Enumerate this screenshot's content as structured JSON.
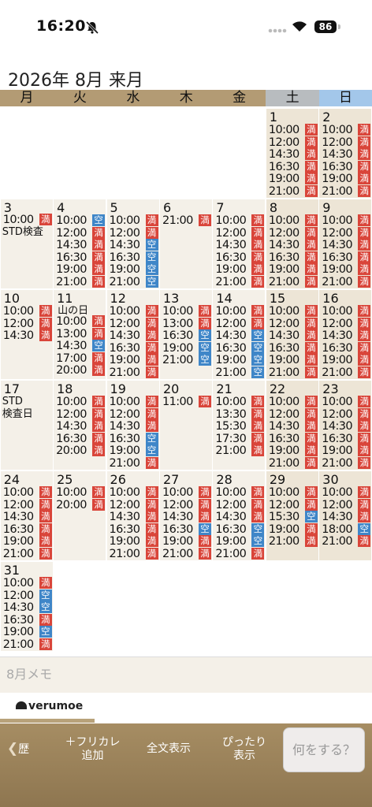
{
  "status_bar": {
    "time": "16:20",
    "battery": "86"
  },
  "calendar": {
    "title": "2026年 8月 来月",
    "weekdays": [
      {
        "label": "月",
        "color": "#b39b74"
      },
      {
        "label": "火",
        "color": "#b39b74"
      },
      {
        "label": "水",
        "color": "#b39b74"
      },
      {
        "label": "木",
        "color": "#b39b74"
      },
      {
        "label": "金",
        "color": "#b39b74"
      },
      {
        "label": "土",
        "color": "#b8bcbf"
      },
      {
        "label": "日",
        "color": "#a3c7ea"
      }
    ],
    "colors": {
      "full": "#d9453a",
      "open": "#3f86c8"
    },
    "badges": {
      "full": "満",
      "open": "空"
    },
    "days": [
      {
        "date": "1",
        "slots": [
          {
            "time": "10:00",
            "status": "full"
          },
          {
            "time": "12:00",
            "status": "full"
          },
          {
            "time": "14:30",
            "status": "full"
          },
          {
            "time": "16:30",
            "status": "full"
          },
          {
            "time": "19:00",
            "status": "full"
          },
          {
            "time": "21:00",
            "status": "full"
          }
        ]
      },
      {
        "date": "2",
        "slots": [
          {
            "time": "10:00",
            "status": "full"
          },
          {
            "time": "12:00",
            "status": "full"
          },
          {
            "time": "14:30",
            "status": "full"
          },
          {
            "time": "16:30",
            "status": "full"
          },
          {
            "time": "19:00",
            "status": "full"
          },
          {
            "time": "21:00",
            "status": "full"
          }
        ]
      },
      {
        "date": "3",
        "note": "STD検査",
        "slots": [
          {
            "time": "10:00",
            "status": "full"
          }
        ]
      },
      {
        "date": "4",
        "slots": [
          {
            "time": "10:00",
            "status": "open"
          },
          {
            "time": "12:00",
            "status": "full"
          },
          {
            "time": "14:30",
            "status": "full"
          },
          {
            "time": "16:30",
            "status": "full"
          },
          {
            "time": "19:00",
            "status": "full"
          },
          {
            "time": "21:00",
            "status": "full"
          }
        ]
      },
      {
        "date": "5",
        "slots": [
          {
            "time": "10:00",
            "status": "full"
          },
          {
            "time": "12:00",
            "status": "full"
          },
          {
            "time": "14:30",
            "status": "open"
          },
          {
            "time": "16:30",
            "status": "open"
          },
          {
            "time": "19:00",
            "status": "open"
          },
          {
            "time": "21:00",
            "status": "open"
          }
        ]
      },
      {
        "date": "6",
        "slots": [
          {
            "time": "21:00",
            "status": "full"
          }
        ]
      },
      {
        "date": "7",
        "slots": [
          {
            "time": "10:00",
            "status": "full"
          },
          {
            "time": "12:00",
            "status": "full"
          },
          {
            "time": "14:30",
            "status": "full"
          },
          {
            "time": "16:30",
            "status": "full"
          },
          {
            "time": "19:00",
            "status": "full"
          },
          {
            "time": "21:00",
            "status": "full"
          }
        ]
      },
      {
        "date": "8",
        "slots": [
          {
            "time": "10:00",
            "status": "full"
          },
          {
            "time": "12:00",
            "status": "full"
          },
          {
            "time": "14:30",
            "status": "full"
          },
          {
            "time": "16:30",
            "status": "full"
          },
          {
            "time": "19:00",
            "status": "full"
          },
          {
            "time": "21:00",
            "status": "full"
          }
        ]
      },
      {
        "date": "9",
        "slots": [
          {
            "time": "10:00",
            "status": "full"
          },
          {
            "time": "12:00",
            "status": "full"
          },
          {
            "time": "14:30",
            "status": "full"
          },
          {
            "time": "16:30",
            "status": "full"
          },
          {
            "time": "19:00",
            "status": "full"
          },
          {
            "time": "21:00",
            "status": "full"
          }
        ]
      },
      {
        "date": "10",
        "slots": [
          {
            "time": "10:00",
            "status": "full"
          },
          {
            "time": "12:00",
            "status": "full"
          },
          {
            "time": "14:30",
            "status": "full"
          }
        ]
      },
      {
        "date": "11",
        "note": "山の日",
        "slots": [
          {
            "time": "10:00",
            "status": "full"
          },
          {
            "time": "13:00",
            "status": "full"
          },
          {
            "time": "14:30",
            "status": "open"
          },
          {
            "time": "17:00",
            "status": "full"
          },
          {
            "time": "20:00",
            "status": "full"
          }
        ]
      },
      {
        "date": "12",
        "slots": [
          {
            "time": "10:00",
            "status": "full"
          },
          {
            "time": "12:00",
            "status": "full"
          },
          {
            "time": "14:30",
            "status": "full"
          },
          {
            "time": "16:30",
            "status": "full"
          },
          {
            "time": "19:00",
            "status": "full"
          },
          {
            "time": "21:00",
            "status": "full"
          }
        ]
      },
      {
        "date": "13",
        "slots": [
          {
            "time": "10:00",
            "status": "full"
          },
          {
            "time": "13:00",
            "status": "full"
          },
          {
            "time": "16:30",
            "status": "open"
          },
          {
            "time": "19:00",
            "status": "open"
          },
          {
            "time": "21:00",
            "status": "open"
          }
        ]
      },
      {
        "date": "14",
        "slots": [
          {
            "time": "10:00",
            "status": "full"
          },
          {
            "time": "12:00",
            "status": "full"
          },
          {
            "time": "14:30",
            "status": "open"
          },
          {
            "time": "16:30",
            "status": "open"
          },
          {
            "time": "19:00",
            "status": "open"
          },
          {
            "time": "21:00",
            "status": "open"
          }
        ]
      },
      {
        "date": "15",
        "slots": [
          {
            "time": "10:00",
            "status": "full"
          },
          {
            "time": "12:00",
            "status": "full"
          },
          {
            "time": "14:30",
            "status": "full"
          },
          {
            "time": "16:30",
            "status": "full"
          },
          {
            "time": "19:00",
            "status": "full"
          },
          {
            "time": "21:00",
            "status": "full"
          }
        ]
      },
      {
        "date": "16",
        "slots": [
          {
            "time": "10:00",
            "status": "full"
          },
          {
            "time": "12:00",
            "status": "full"
          },
          {
            "time": "14:30",
            "status": "full"
          },
          {
            "time": "16:30",
            "status": "full"
          },
          {
            "time": "19:00",
            "status": "full"
          },
          {
            "time": "21:00",
            "status": "full"
          }
        ]
      },
      {
        "date": "17",
        "note": "STD\n検査日",
        "slots": []
      },
      {
        "date": "18",
        "slots": [
          {
            "time": "10:00",
            "status": "full"
          },
          {
            "time": "12:00",
            "status": "full"
          },
          {
            "time": "14:30",
            "status": "full"
          },
          {
            "time": "16:30",
            "status": "full"
          },
          {
            "time": "20:00",
            "status": "full"
          }
        ]
      },
      {
        "date": "19",
        "slots": [
          {
            "time": "10:00",
            "status": "full"
          },
          {
            "time": "12:00",
            "status": "full"
          },
          {
            "time": "14:30",
            "status": "full"
          },
          {
            "time": "16:30",
            "status": "open"
          },
          {
            "time": "19:00",
            "status": "open"
          },
          {
            "time": "21:00",
            "status": "full"
          }
        ]
      },
      {
        "date": "20",
        "slots": [
          {
            "time": "11:00",
            "status": "full"
          }
        ]
      },
      {
        "date": "21",
        "slots": [
          {
            "time": "10:00",
            "status": "full"
          },
          {
            "time": "13:30",
            "status": "full"
          },
          {
            "time": "15:30",
            "status": "full"
          },
          {
            "time": "17:30",
            "status": "full"
          },
          {
            "time": "21:00",
            "status": "full"
          }
        ]
      },
      {
        "date": "22",
        "slots": [
          {
            "time": "10:00",
            "status": "full"
          },
          {
            "time": "12:00",
            "status": "full"
          },
          {
            "time": "14:30",
            "status": "full"
          },
          {
            "time": "16:30",
            "status": "full"
          },
          {
            "time": "19:00",
            "status": "full"
          },
          {
            "time": "21:00",
            "status": "full"
          }
        ]
      },
      {
        "date": "23",
        "slots": [
          {
            "time": "10:00",
            "status": "full"
          },
          {
            "time": "12:00",
            "status": "full"
          },
          {
            "time": "14:30",
            "status": "full"
          },
          {
            "time": "16:30",
            "status": "full"
          },
          {
            "time": "19:00",
            "status": "full"
          },
          {
            "time": "21:00",
            "status": "full"
          }
        ]
      },
      {
        "date": "24",
        "slots": [
          {
            "time": "10:00",
            "status": "full"
          },
          {
            "time": "12:00",
            "status": "full"
          },
          {
            "time": "14:30",
            "status": "full"
          },
          {
            "time": "16:30",
            "status": "full"
          },
          {
            "time": "19:00",
            "status": "full"
          },
          {
            "time": "21:00",
            "status": "full"
          }
        ]
      },
      {
        "date": "25",
        "slots": [
          {
            "time": "10:00",
            "status": "full"
          },
          {
            "time": "20:00",
            "status": "full"
          }
        ]
      },
      {
        "date": "26",
        "slots": [
          {
            "time": "10:00",
            "status": "full"
          },
          {
            "time": "12:00",
            "status": "full"
          },
          {
            "time": "14:30",
            "status": "full"
          },
          {
            "time": "16:30",
            "status": "full"
          },
          {
            "time": "19:00",
            "status": "full"
          },
          {
            "time": "21:00",
            "status": "full"
          }
        ]
      },
      {
        "date": "27",
        "slots": [
          {
            "time": "10:00",
            "status": "full"
          },
          {
            "time": "12:00",
            "status": "full"
          },
          {
            "time": "14:30",
            "status": "full"
          },
          {
            "time": "16:30",
            "status": "open"
          },
          {
            "time": "19:00",
            "status": "full"
          },
          {
            "time": "21:00",
            "status": "full"
          }
        ]
      },
      {
        "date": "28",
        "slots": [
          {
            "time": "10:00",
            "status": "full"
          },
          {
            "time": "12:00",
            "status": "full"
          },
          {
            "time": "14:30",
            "status": "full"
          },
          {
            "time": "16:30",
            "status": "open"
          },
          {
            "time": "19:00",
            "status": "open"
          },
          {
            "time": "21:00",
            "status": "full"
          }
        ]
      },
      {
        "date": "29",
        "slots": [
          {
            "time": "10:00",
            "status": "full"
          },
          {
            "time": "12:00",
            "status": "full"
          },
          {
            "time": "15:30",
            "status": "open"
          },
          {
            "time": "19:00",
            "status": "full"
          },
          {
            "time": "21:00",
            "status": "full"
          }
        ]
      },
      {
        "date": "30",
        "slots": [
          {
            "time": "10:00",
            "status": "full"
          },
          {
            "time": "12:00",
            "status": "full"
          },
          {
            "time": "14:30",
            "status": "full"
          },
          {
            "time": "18:00",
            "status": "open"
          },
          {
            "time": "21:00",
            "status": "full"
          }
        ]
      },
      {
        "date": "31",
        "slots": [
          {
            "time": "10:00",
            "status": "full"
          },
          {
            "time": "12:00",
            "status": "open"
          },
          {
            "time": "14:30",
            "status": "open"
          },
          {
            "time": "16:30",
            "status": "full"
          },
          {
            "time": "19:00",
            "status": "open"
          },
          {
            "time": "21:00",
            "status": "full"
          }
        ]
      }
    ]
  },
  "memo": {
    "placeholder": "8月メモ"
  },
  "brand": {
    "logo_text": "verumoe"
  },
  "toolbar": {
    "back_label": "歴",
    "furigana_label": "＋フリカレ\n追加",
    "fulltext_label": "全文表示",
    "fit_label": "ぴったり\n表示",
    "action_label": "何をする？"
  }
}
